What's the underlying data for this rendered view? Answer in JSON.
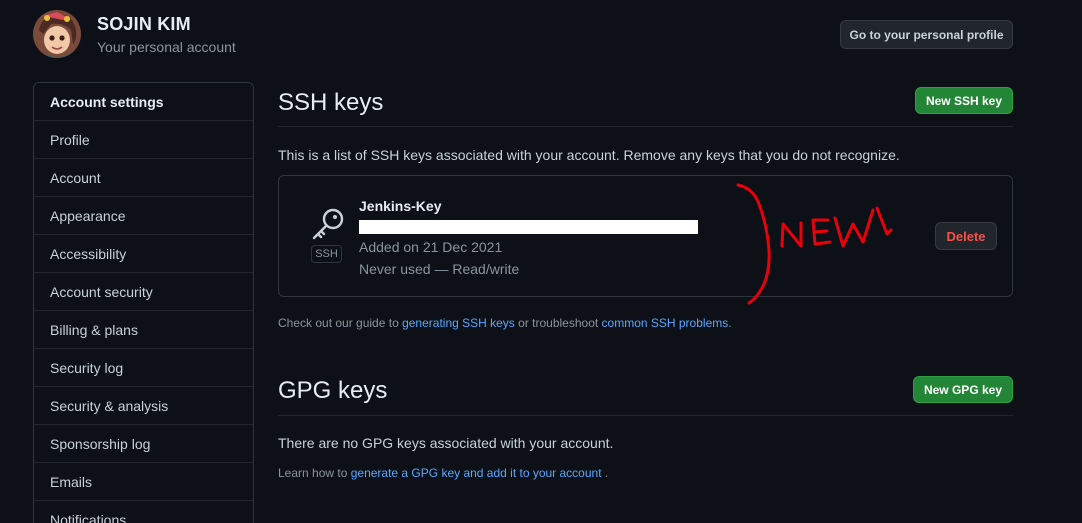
{
  "user": {
    "name": "SOJIN KIM",
    "subtitle": "Your personal account",
    "profile_button": "Go to your personal profile"
  },
  "sidebar": {
    "header": "Account settings",
    "items": [
      {
        "label": "Profile"
      },
      {
        "label": "Account"
      },
      {
        "label": "Appearance"
      },
      {
        "label": "Accessibility"
      },
      {
        "label": "Account security"
      },
      {
        "label": "Billing & plans"
      },
      {
        "label": "Security log"
      },
      {
        "label": "Security & analysis"
      },
      {
        "label": "Sponsorship log"
      },
      {
        "label": "Emails"
      },
      {
        "label": "Notifications"
      }
    ]
  },
  "ssh": {
    "title": "SSH keys",
    "new_button": "New SSH key",
    "description": "This is a list of SSH keys associated with your account. Remove any keys that you do not recognize.",
    "key": {
      "name": "Jenkins-Key",
      "type_label": "SSH",
      "added": "Added on 21 Dec 2021",
      "usage": "Never used — Read/write",
      "delete_button": "Delete"
    },
    "hint": {
      "prefix": "Check out our guide to ",
      "link1": "generating SSH keys",
      "middle": " or troubleshoot ",
      "link2": "common SSH problems",
      "suffix": "."
    }
  },
  "annotation": {
    "text": "NEW",
    "color": "#e8000b"
  },
  "gpg": {
    "title": "GPG keys",
    "new_button": "New GPG key",
    "description": "There are no GPG keys associated with your account.",
    "hint": {
      "prefix": "Learn how to ",
      "link": "generate a GPG key and add it to your account",
      "suffix": " ."
    }
  },
  "colors": {
    "background": "#0d1117",
    "border": "#30363d",
    "link": "#58a6ff",
    "green_button": "#238636",
    "danger_text": "#f85149"
  },
  "icons": [
    "avatar",
    "key-icon"
  ]
}
